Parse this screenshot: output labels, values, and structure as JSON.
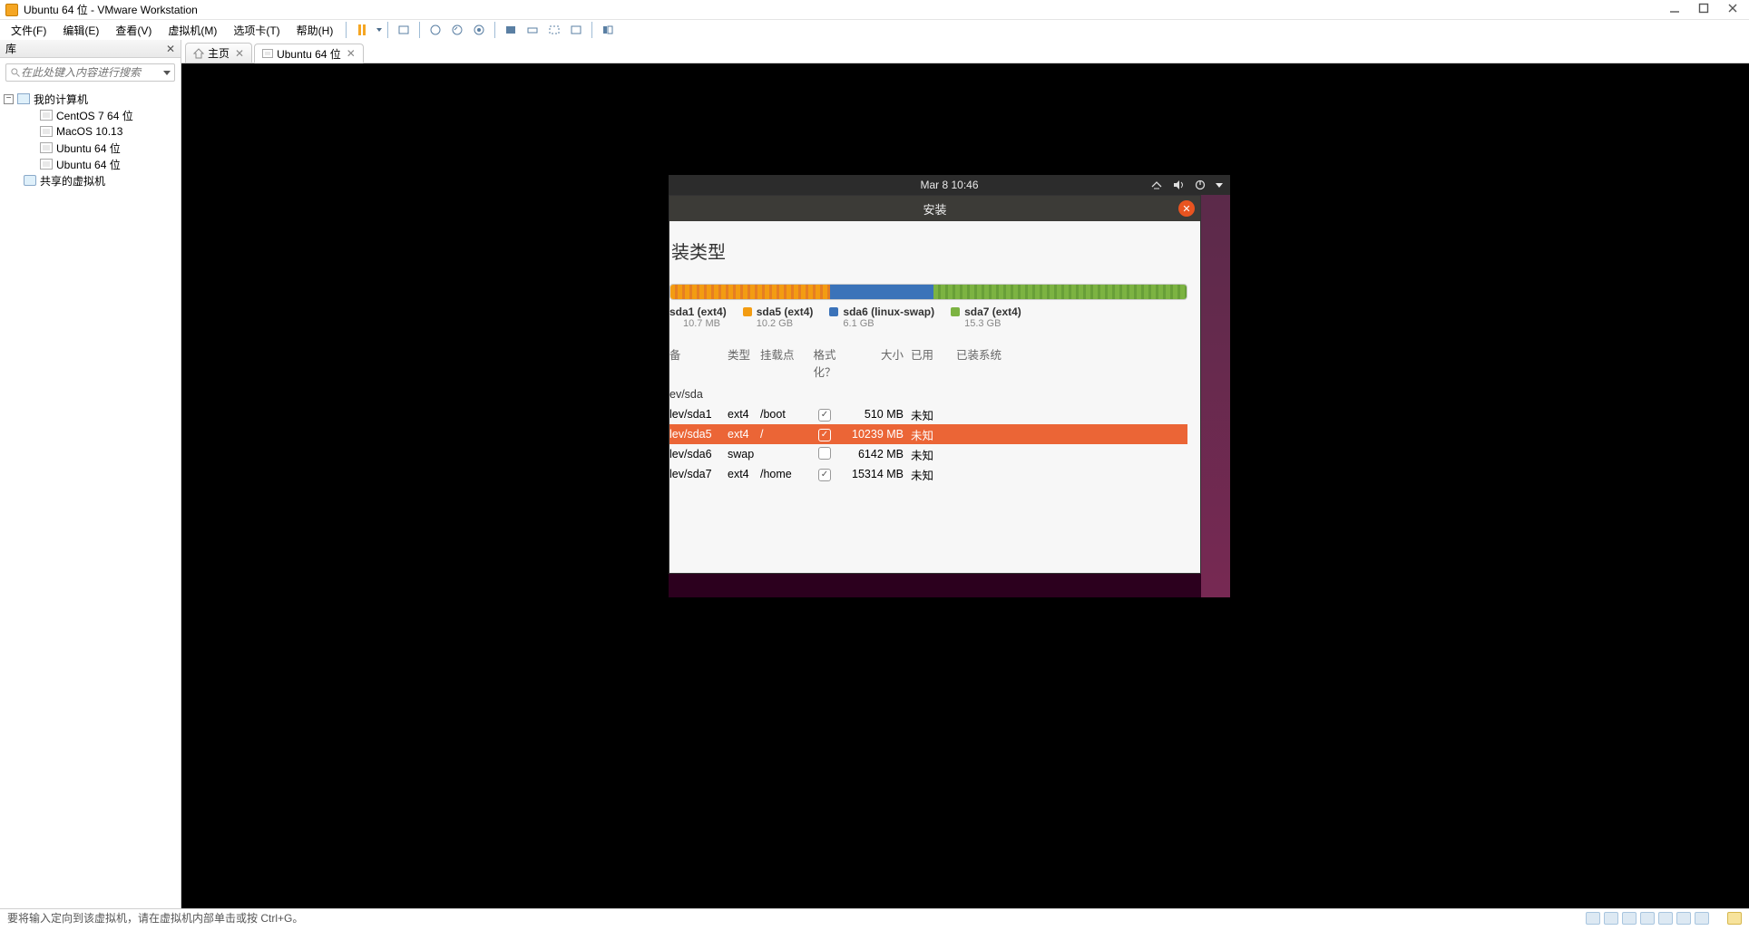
{
  "titlebar": {
    "title": "Ubuntu 64 位 - VMware Workstation"
  },
  "menu": {
    "file": "文件(F)",
    "edit": "编辑(E)",
    "view": "查看(V)",
    "vm": "虚拟机(M)",
    "tabs": "选项卡(T)",
    "help": "帮助(H)"
  },
  "sidebar": {
    "title": "库",
    "search_placeholder": "在此处键入内容进行搜索",
    "root": "我的计算机",
    "items": [
      "CentOS 7 64 位",
      "MacOS 10.13",
      "Ubuntu 64 位",
      "Ubuntu 64 位"
    ],
    "shared": "共享的虚拟机"
  },
  "tabs": {
    "home": "主页",
    "vm": "Ubuntu 64 位"
  },
  "gnome": {
    "datetime": "Mar 8  10:46"
  },
  "installer": {
    "window_title": "安装",
    "heading": "装类型",
    "legend": [
      {
        "label": "sda1 (ext4)",
        "size": "10.7 MB",
        "color": "#f39c12"
      },
      {
        "label": "sda5 (ext4)",
        "size": "10.2 GB",
        "color": "#f39c12"
      },
      {
        "label": "sda6 (linux-swap)",
        "size": "6.1 GB",
        "color": "#3b73b9"
      },
      {
        "label": "sda7 (ext4)",
        "size": "15.3 GB",
        "color": "#7cb342"
      }
    ],
    "columns": {
      "device": "备",
      "type": "类型",
      "mount": "挂载点",
      "format": "格式化？",
      "size": "大小",
      "used": "已用",
      "system": "已装系统"
    },
    "group_row": "ev/sda",
    "rows": [
      {
        "device": "lev/sda1",
        "type": "ext4",
        "mount": "/boot",
        "format": true,
        "size": "510 MB",
        "used": "未知",
        "selected": false
      },
      {
        "device": "lev/sda5",
        "type": "ext4",
        "mount": "/",
        "format": true,
        "size": "10239 MB",
        "used": "未知",
        "selected": true
      },
      {
        "device": "lev/sda6",
        "type": "swap",
        "mount": "",
        "format": false,
        "size": "6142 MB",
        "used": "未知",
        "selected": false
      },
      {
        "device": "lev/sda7",
        "type": "ext4",
        "mount": "/home",
        "format": true,
        "size": "15314 MB",
        "used": "未知",
        "selected": false
      }
    ]
  },
  "statusbar": {
    "text": "要将输入定向到该虚拟机，请在虚拟机内部单击或按 Ctrl+G。"
  }
}
